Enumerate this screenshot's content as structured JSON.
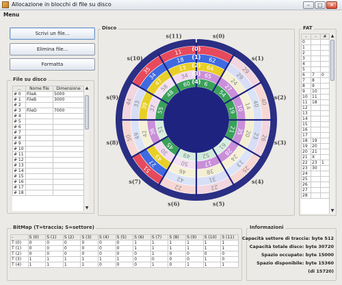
{
  "window": {
    "title": "Allocazione in blocchi di file su disco",
    "minimize": "–",
    "maximize": "□",
    "close": "✕"
  },
  "menu": {
    "label": "Menu"
  },
  "buttons": {
    "scrivi": "Scrivi un file...",
    "elimina": "Elimina file...",
    "formatta": "Formatta"
  },
  "files_panel": {
    "title": "File su disco",
    "headers": [
      "...",
      "Nome file",
      "Dimensione"
    ],
    "rows": [
      [
        "# 0",
        "FileA",
        "5000"
      ],
      [
        "# 1",
        "FileB",
        "3000"
      ],
      [
        "# 2",
        "",
        ""
      ],
      [
        "# 3",
        "FileD",
        "7000"
      ],
      [
        "# 4",
        "",
        ""
      ],
      [
        "# 5",
        "",
        ""
      ],
      [
        "# 6",
        "",
        ""
      ],
      [
        "# 7",
        "",
        ""
      ],
      [
        "# 8",
        "",
        ""
      ],
      [
        "# 9",
        "",
        ""
      ],
      [
        "# 10",
        "",
        ""
      ],
      [
        "# 11",
        "",
        ""
      ],
      [
        "# 12",
        "",
        ""
      ],
      [
        "# 13",
        "",
        ""
      ],
      [
        "# 14",
        "",
        ""
      ],
      [
        "# 15",
        "",
        ""
      ],
      [
        "# 16",
        "",
        ""
      ],
      [
        "# 17",
        "",
        ""
      ],
      [
        "# 18",
        "",
        ""
      ]
    ]
  },
  "disk_panel": {
    "title": "Disco",
    "track_labels": [
      "T",
      "0",
      "1",
      "2",
      "3",
      "4"
    ],
    "sector_labels": [
      "s(0)",
      "s(1)",
      "s(2)",
      "s(3)",
      "s(4)",
      "s(5)",
      "s(6)",
      "s(7)",
      "s(8)",
      "s(9)",
      "s(10)",
      "s(11)"
    ],
    "blocks": [
      [
        null,
        "29",
        "40",
        "26",
        "25",
        "22",
        "22",
        "51",
        "50",
        "44",
        "35",
        "11"
      ],
      [
        "62",
        "29",
        "40",
        "23",
        "13",
        "31",
        "42",
        "27",
        "49",
        "33",
        "34",
        "18"
      ],
      [
        "64",
        "24",
        "14",
        "20",
        "24",
        "38",
        "46",
        "43",
        "42",
        "39",
        "47",
        "13"
      ],
      [
        "65",
        "27",
        "10",
        "35",
        "28",
        "17",
        "50",
        "30",
        "36",
        "37",
        "58",
        "34"
      ],
      [
        "6",
        "54",
        "19",
        "21",
        "61",
        "52",
        "49",
        "45",
        "51",
        "55",
        "48",
        "60"
      ]
    ],
    "colors": {
      "ring_bg": "#2a2f84",
      "center": "#1f2380",
      "divider": "#1f2380"
    }
  },
  "fat_panel": {
    "title": "FAT",
    "headers": [
      "-",
      "-",
      "#"
    ],
    "rows": [
      [
        "0",
        ""
      ],
      [
        "1",
        ""
      ],
      [
        "2",
        ""
      ],
      [
        "3",
        ""
      ],
      [
        "4",
        ""
      ],
      [
        "5",
        ""
      ],
      [
        "6",
        "7",
        "0"
      ],
      [
        "7",
        "8"
      ],
      [
        "8",
        "9"
      ],
      [
        "9",
        "10"
      ],
      [
        "10",
        "11"
      ],
      [
        "11",
        "18"
      ],
      [
        "12",
        ""
      ],
      [
        "13",
        ""
      ],
      [
        "14",
        ""
      ],
      [
        "15",
        ""
      ],
      [
        "16",
        ""
      ],
      [
        "17",
        ""
      ],
      [
        "18",
        "19"
      ],
      [
        "19",
        "20"
      ],
      [
        "20",
        "21"
      ],
      [
        "21",
        "X"
      ],
      [
        "22",
        "23",
        "1"
      ],
      [
        "23",
        "30"
      ],
      [
        "24",
        ""
      ],
      [
        "25",
        ""
      ],
      [
        "26",
        ""
      ],
      [
        "27",
        ""
      ],
      [
        "28",
        ""
      ]
    ]
  },
  "bitmap_panel": {
    "title": "BitMap  (T=traccia; S=settore)",
    "headers": [
      "-",
      "S (0)",
      "S (1)",
      "S (2)",
      "S (3)",
      "S (4)",
      "S (5)",
      "S (6)",
      "S (7)",
      "S (8)",
      "S (9)",
      "S (10)",
      "S (11)"
    ],
    "rows": [
      [
        "T (0)",
        "0",
        "0",
        "0",
        "0",
        "0",
        "0",
        "1",
        "1",
        "1",
        "1",
        "1",
        "1"
      ],
      [
        "T (1)",
        "0",
        "0",
        "0",
        "0",
        "0",
        "0",
        "1",
        "1",
        "1",
        "1",
        "1",
        "1"
      ],
      [
        "T (2)",
        "0",
        "0",
        "0",
        "0",
        "0",
        "0",
        "0",
        "1",
        "0",
        "0",
        "0",
        "0"
      ],
      [
        "T (3)",
        "1",
        "1",
        "1",
        "1",
        "1",
        "1",
        "0",
        "0",
        "0",
        "0",
        "1",
        "0"
      ],
      [
        "T (4)",
        "1",
        "1",
        "1",
        "1",
        "0",
        "0",
        "0",
        "1",
        "0",
        "1",
        "1",
        "1"
      ]
    ]
  },
  "info_panel": {
    "title": "Informazioni",
    "lines": [
      "Capacità settore di traccia: byte 512",
      "Capacità totale disco: byte 30720",
      "Spazio occupato: byte 15000",
      "Spazio disponibile: byte 15360",
      "(di 15720)"
    ]
  }
}
